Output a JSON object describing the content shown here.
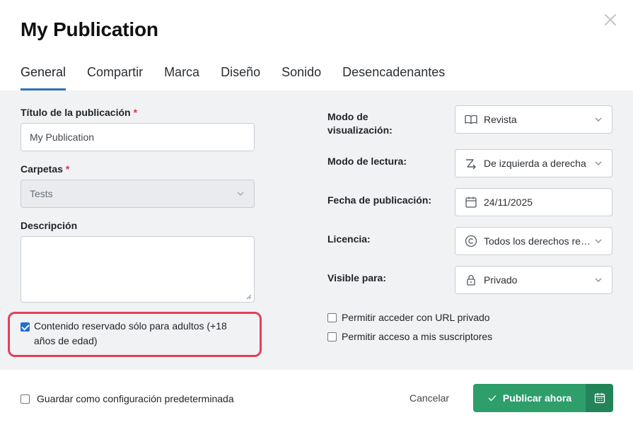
{
  "header": {
    "title": "My Publication",
    "tabs": [
      {
        "label": "General",
        "active": true
      },
      {
        "label": "Compartir"
      },
      {
        "label": "Marca"
      },
      {
        "label": "Diseño"
      },
      {
        "label": "Sonido"
      },
      {
        "label": "Desencadenantes"
      }
    ]
  },
  "left": {
    "title_label": "Título de la publicación",
    "title_required": "*",
    "title_value": "My Publication",
    "folders_label": "Carpetas",
    "folders_required": "*",
    "folders_value": "Tests",
    "description_label": "Descripción",
    "description_value": "",
    "adult_label": "Contenido reservado sólo para adultos (+18 años de edad)",
    "adult_checked": true
  },
  "right": {
    "view_mode_label": "Modo de visualización:",
    "view_mode_value": "Revista",
    "reading_mode_label": "Modo de lectura:",
    "reading_mode_value": "De izquierda a derecha",
    "date_label": "Fecha de publicación:",
    "date_value": "24/11/2025",
    "license_label": "Licencia:",
    "license_value": "Todos los derechos reservados",
    "visible_label": "Visible para:",
    "visible_value": "Privado",
    "private_url_label": "Permitir acceder con URL privado",
    "subscribers_label": "Permitir acceso a mis suscriptores"
  },
  "footer": {
    "default_label": "Guardar como configuración predeterminada",
    "cancel_label": "Cancelar",
    "publish_label": "Publicar ahora"
  },
  "colors": {
    "accent_tab": "#2f6fbf",
    "publish_green": "#2e9e6b",
    "highlight_red": "#e0405a"
  },
  "icons": [
    "close-icon",
    "book-icon",
    "reading-direction-icon",
    "calendar-icon",
    "copyright-icon",
    "lock-icon",
    "chevron-down-icon",
    "check-icon",
    "schedule-calendar-icon"
  ]
}
